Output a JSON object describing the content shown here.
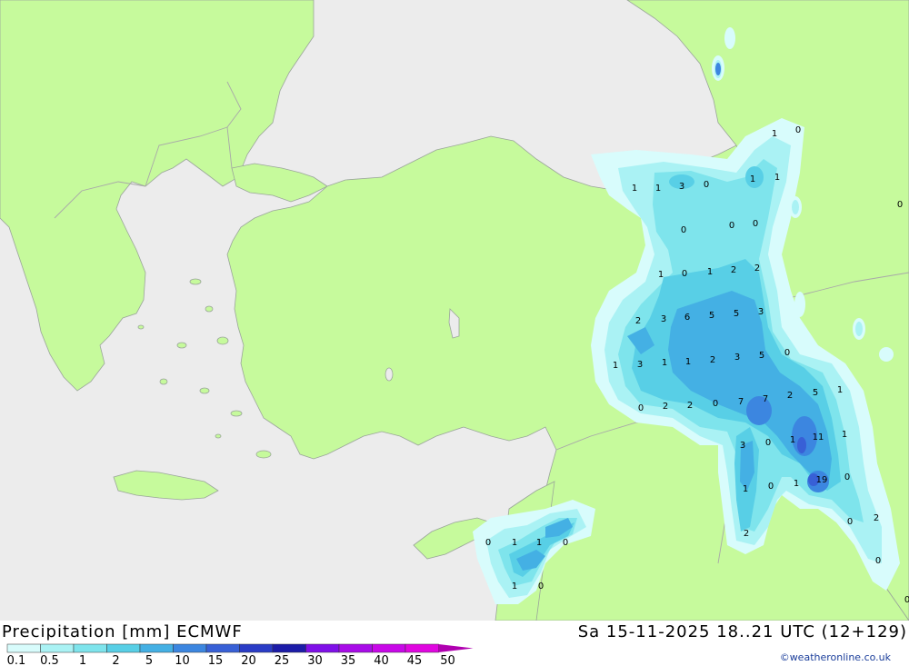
{
  "title": "Precipitation [mm] ECMWF",
  "validity": "Sa 15-11-2025 18..21 UTC (12+129)",
  "credit": "©weatheronline.co.uk",
  "colors": {
    "sea": "#ececec",
    "land": "#c6fa9c",
    "border": "#a0a0a0"
  },
  "legend": {
    "labels": [
      "0.1",
      "0.5",
      "1",
      "2",
      "5",
      "10",
      "15",
      "20",
      "25",
      "30",
      "35",
      "40",
      "45",
      "50"
    ],
    "colors": [
      "#d8fcfc",
      "#aaf2f4",
      "#7ee4ec",
      "#58cfe6",
      "#44b0e4",
      "#3c86e0",
      "#3860d6",
      "#2a3cc6",
      "#1c1ca8",
      "#7f10e8",
      "#a80ce8",
      "#c808e8",
      "#e006e0",
      "#b000b0"
    ]
  },
  "precip_values": [
    {
      "v": "1"
    },
    {
      "v": "0"
    },
    {
      "v": "1"
    },
    {
      "v": "1"
    },
    {
      "v": "3"
    },
    {
      "v": "0"
    },
    {
      "v": "1"
    },
    {
      "v": "1"
    },
    {
      "v": "0"
    },
    {
      "v": "0"
    },
    {
      "v": "0"
    },
    {
      "v": "0"
    },
    {
      "v": "1"
    },
    {
      "v": "0"
    },
    {
      "v": "1"
    },
    {
      "v": "2"
    },
    {
      "v": "2"
    },
    {
      "v": "2"
    },
    {
      "v": "3"
    },
    {
      "v": "6"
    },
    {
      "v": "5"
    },
    {
      "v": "5"
    },
    {
      "v": "3"
    },
    {
      "v": "1"
    },
    {
      "v": "3"
    },
    {
      "v": "1"
    },
    {
      "v": "1"
    },
    {
      "v": "2"
    },
    {
      "v": "3"
    },
    {
      "v": "5"
    },
    {
      "v": "0"
    },
    {
      "v": "0"
    },
    {
      "v": "2"
    },
    {
      "v": "2"
    },
    {
      "v": "0"
    },
    {
      "v": "7"
    },
    {
      "v": "7"
    },
    {
      "v": "2"
    },
    {
      "v": "5"
    },
    {
      "v": "1"
    },
    {
      "v": "3"
    },
    {
      "v": "0"
    },
    {
      "v": "1"
    },
    {
      "v": "11"
    },
    {
      "v": "1"
    },
    {
      "v": "1"
    },
    {
      "v": "0"
    },
    {
      "v": "1"
    },
    {
      "v": "19"
    },
    {
      "v": "0"
    },
    {
      "v": "0"
    },
    {
      "v": "2"
    },
    {
      "v": "2"
    },
    {
      "v": "0"
    },
    {
      "v": "0"
    },
    {
      "v": "1"
    },
    {
      "v": "1"
    },
    {
      "v": "0"
    },
    {
      "v": "1"
    },
    {
      "v": "0"
    },
    {
      "v": "0"
    }
  ]
}
